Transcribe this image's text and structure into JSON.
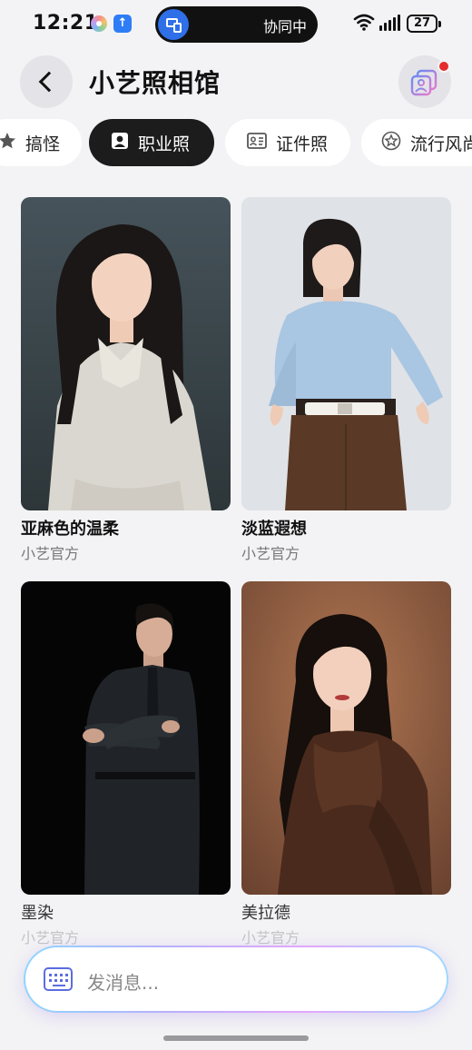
{
  "status_bar": {
    "time": "12:21",
    "collab_text": "协同中",
    "battery": "27"
  },
  "header": {
    "title": "小艺照相馆"
  },
  "tabs": [
    {
      "label": "搞怪",
      "icon": "star-icon",
      "active": false
    },
    {
      "label": "职业照",
      "icon": "portrait-icon",
      "active": true
    },
    {
      "label": "证件照",
      "icon": "id-card-icon",
      "active": false
    },
    {
      "label": "流行风尚",
      "icon": "star-circle-icon",
      "active": false
    }
  ],
  "cards": [
    {
      "title": "亚麻色的温柔",
      "author": "小艺官方"
    },
    {
      "title": "淡蓝遐想",
      "author": "小艺官方"
    },
    {
      "title": "墨染",
      "author": "小艺官方"
    },
    {
      "title": "美拉德",
      "author": "小艺官方"
    }
  ],
  "message_bar": {
    "placeholder": "发消息..."
  },
  "colors": {
    "background": "#f3f3f5",
    "active_tab": "#1c1c1c",
    "badge": "#e52b2b",
    "collab_icon": "#2f6fe8"
  }
}
